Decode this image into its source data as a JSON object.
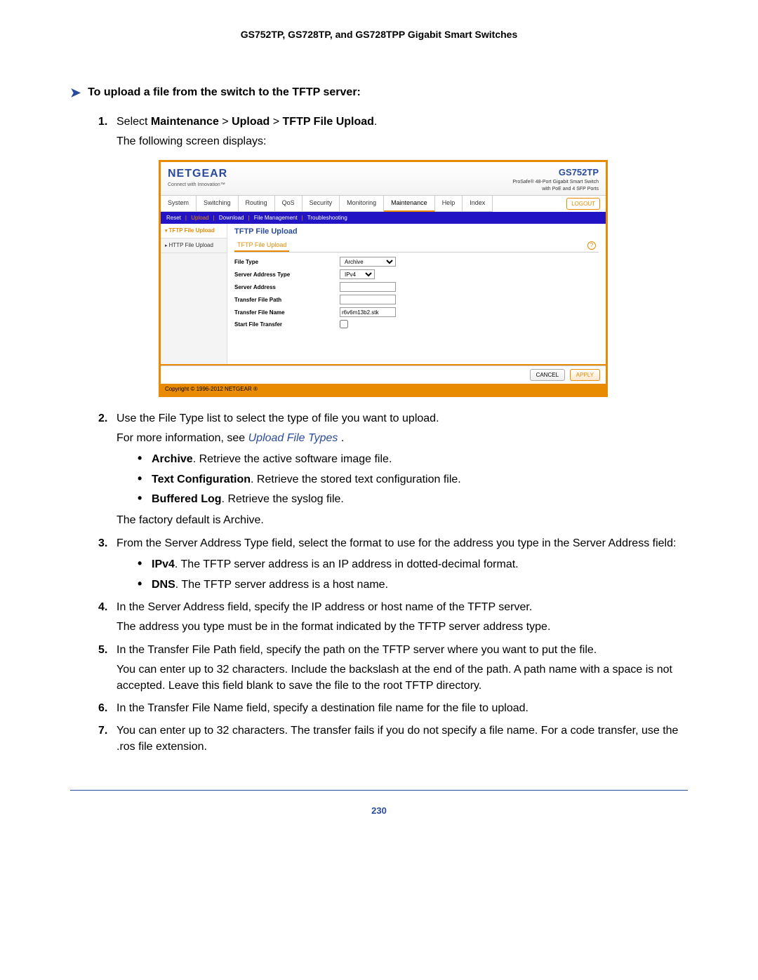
{
  "header": {
    "title": "GS752TP, GS728TP, and GS728TPP Gigabit Smart Switches"
  },
  "section": {
    "arrow": "➤",
    "heading": "To upload a file from the switch to the TFTP server:"
  },
  "steps": {
    "s1": {
      "num": "1.",
      "prefix": "Select ",
      "path_a": "Maintenance",
      "sep": " > ",
      "path_b": "Upload",
      "path_c": "TFTP File Upload",
      "suffix": ".",
      "line2": "The following screen displays:"
    },
    "s2": {
      "num": "2.",
      "text": "Use the File Type list to select the type of file you want to upload.",
      "line2a": "For more information, see ",
      "link": "Upload File Types",
      "line2b": " .",
      "b1_bold": "Archive",
      "b1_rest": ". Retrieve the active software image file.",
      "b2_bold": "Text Configuration",
      "b2_rest": ". Retrieve the stored text configuration file.",
      "b3_bold": "Buffered Log",
      "b3_rest": ". Retrieve the syslog file.",
      "line3": "The factory default is Archive."
    },
    "s3": {
      "num": "3.",
      "text": "From the Server Address Type field, select the format to use for the address you type in the Server Address field:",
      "b1_bold": "IPv4",
      "b1_rest": ". The TFTP server address is an IP address in dotted-decimal format.",
      "b2_bold": "DNS",
      "b2_rest": ". The TFTP server address is a host name."
    },
    "s4": {
      "num": "4.",
      "text": "In the Server Address field, specify the IP address or host name of the TFTP server.",
      "line2": "The address you type must be in the format indicated by the TFTP server address type."
    },
    "s5": {
      "num": "5.",
      "text": "In the Transfer File Path field, specify the path on the TFTP server where you want to put the file.",
      "line2": "You can enter up to 32 characters. Include the backslash at the end of the path. A path name with a space is not accepted. Leave this field blank to save the file to the root TFTP directory."
    },
    "s6": {
      "num": "6.",
      "text": "In the Transfer File Name field, specify a destination file name for the file to upload."
    },
    "s7": {
      "num": "7.",
      "text": "You can enter up to 32 characters. The transfer fails if you do not specify a file name. For a code transfer, use the .ros file extension."
    }
  },
  "screenshot": {
    "brand": "NETGEAR",
    "tagline": "Connect with Innovation™",
    "model": "GS752TP",
    "model_desc1": "ProSafe® 48-Port Gigabit Smart Switch",
    "model_desc2": "with PoE and 4 SFP Ports",
    "tabs": [
      "System",
      "Switching",
      "Routing",
      "QoS",
      "Security",
      "Monitoring",
      "Maintenance",
      "Help",
      "Index"
    ],
    "active_tab_index": 6,
    "logout": "LOGOUT",
    "subtabs": {
      "items": [
        "Reset",
        "Upload",
        "Download",
        "File Management",
        "Troubleshooting"
      ],
      "active_index": 1
    },
    "sidebar": {
      "items": [
        "TFTP File Upload",
        "HTTP File Upload"
      ],
      "active_index": 0
    },
    "panel_title": "TFTP File Upload",
    "panel_subtitle": "TFTP File Upload",
    "help": "?",
    "form": {
      "r1": {
        "label": "File Type",
        "value": "Archive"
      },
      "r2": {
        "label": "Server Address Type",
        "value": "IPv4"
      },
      "r3": {
        "label": "Server Address",
        "value": ""
      },
      "r4": {
        "label": "Transfer File Path",
        "value": ""
      },
      "r5": {
        "label": "Transfer File Name",
        "value": "r6v6m13b2.stk"
      },
      "r6": {
        "label": "Start File Transfer"
      }
    },
    "buttons": {
      "cancel": "CANCEL",
      "apply": "APPLY"
    },
    "copyright": "Copyright © 1996-2012 NETGEAR ®"
  },
  "footer": {
    "page": "230"
  }
}
